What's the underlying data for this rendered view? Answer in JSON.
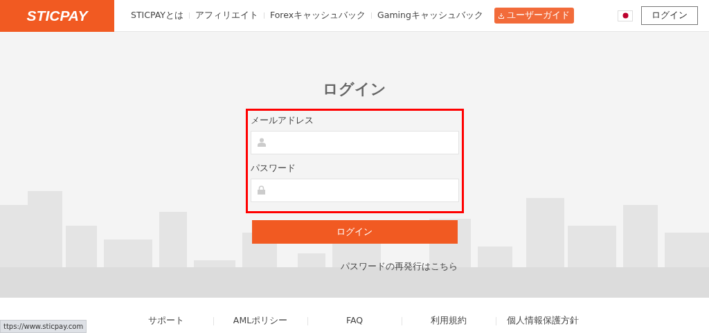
{
  "header": {
    "logo": "STICPAY",
    "nav": [
      "STICPAYとは",
      "アフィリエイト",
      "Forexキャッシュバック",
      "Gamingキャッシュバック"
    ],
    "guide_button": "ユーザーガイド",
    "login_button": "ログイン"
  },
  "login": {
    "title": "ログイン",
    "highlighted": true,
    "fields": [
      {
        "label": "メールアドレス",
        "kind": "user"
      },
      {
        "label": "パスワード",
        "kind": "lock"
      }
    ],
    "submit": "ログイン",
    "reset_link": "パスワードの再発行はこちら"
  },
  "footer": {
    "links": [
      "サポート",
      "AMLポリシー",
      "FAQ",
      "利用規約",
      "個人情報保護方針"
    ]
  },
  "status_bar": "ttps://www.sticpay.com"
}
